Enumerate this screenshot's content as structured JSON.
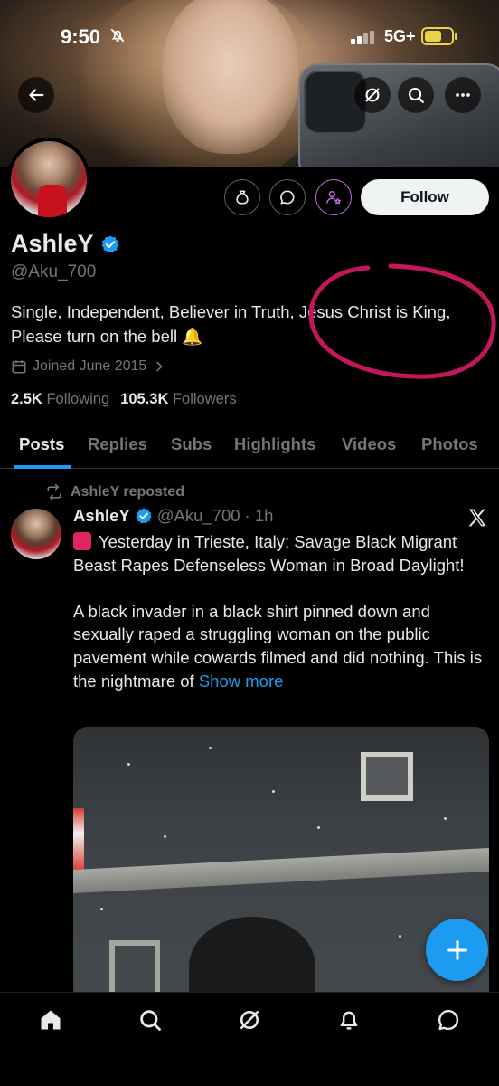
{
  "status_bar": {
    "time": "9:50",
    "network": "5G+",
    "battery_level": 0.65,
    "icons": [
      "bell-slash-icon",
      "signal-icon",
      "battery-charging-icon"
    ]
  },
  "header": {
    "buttons": [
      "back-arrow-icon",
      "grok-icon",
      "search-icon",
      "more-icon"
    ]
  },
  "profile": {
    "display_name": "AshleY",
    "handle": "@Aku_700",
    "bio_line1": "Single, Independent, Believer in Truth, Jesus Christ is King,",
    "bio_line2": "Please turn on the bell 🔔",
    "joined": "Joined June 2015",
    "following_count": "2.5K",
    "following_label": "Following",
    "followers_count": "105.3K",
    "followers_label": "Followers",
    "follow_button": "Follow",
    "verified_color": "#1d9bf0"
  },
  "tabs": [
    {
      "label": "Posts",
      "active": true
    },
    {
      "label": "Replies",
      "active": false
    },
    {
      "label": "Subs",
      "active": false
    },
    {
      "label": "Highlights",
      "active": false
    },
    {
      "label": "Videos",
      "active": false
    },
    {
      "label": "Photos",
      "active": false
    }
  ],
  "post": {
    "repost_label": "AshleY reposted",
    "author": "AshleY",
    "handle": "@Aku_700",
    "time": "· 1h",
    "line1": "Yesterday in Trieste, Italy: Savage Black Migrant Beast Rapes Defenseless Woman in Broad Daylight!",
    "line2": "A black invader in a black shirt pinned down and sexually raped a struggling woman on the public pavement while cowards filmed and did nothing. This is the nightmare of ",
    "show_more": "Show more"
  },
  "bottom_nav": [
    "home-icon",
    "search-icon",
    "grok-icon",
    "notifications-icon",
    "messages-icon"
  ],
  "colors": {
    "accent": "#1d9bf0",
    "subscribe": "#b86bd6",
    "annotation": "#c2185b",
    "background": "#000000"
  }
}
